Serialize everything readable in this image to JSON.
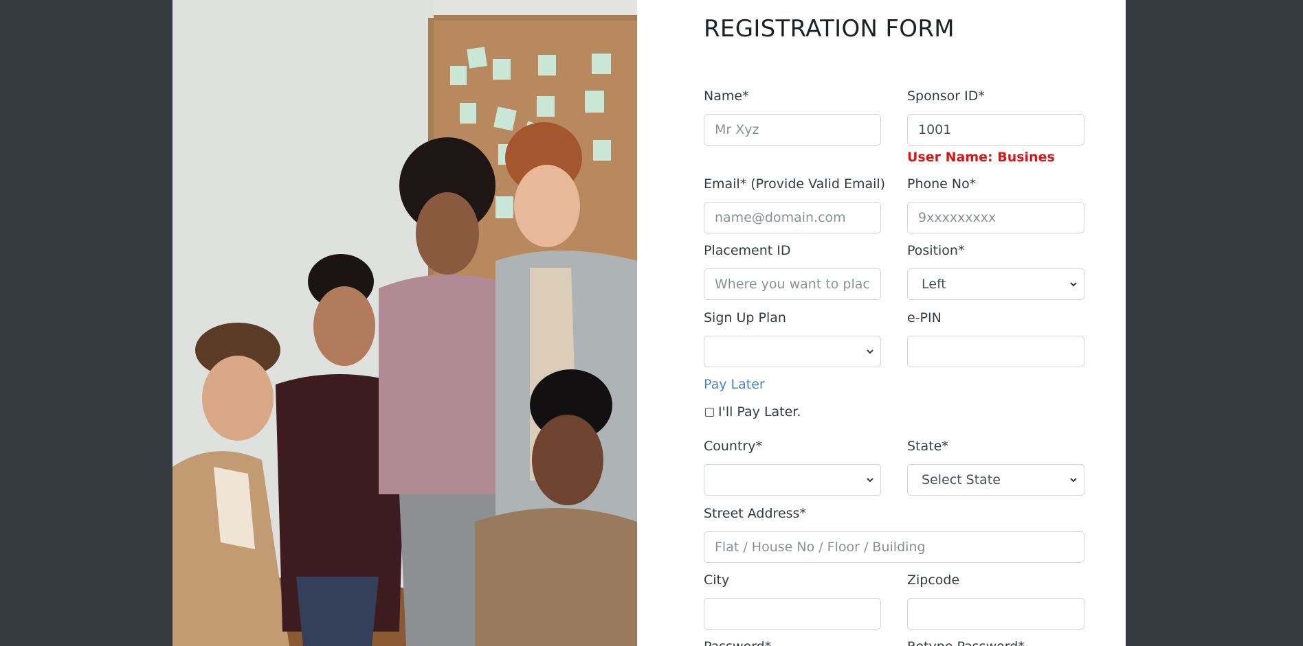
{
  "form": {
    "title": "REGISTRATION FORM",
    "name": {
      "label": "Name*",
      "placeholder": "Mr Xyz",
      "value": ""
    },
    "sponsor": {
      "label": "Sponsor ID*",
      "value": "1001",
      "message": "User Name: Busines"
    },
    "email": {
      "label": "Email* (Provide Valid Email)",
      "placeholder": "name@domain.com"
    },
    "phone": {
      "label": "Phone No*",
      "placeholder": "9xxxxxxxxx"
    },
    "placement": {
      "label": "Placement ID",
      "placeholder": "Where you want to place"
    },
    "position": {
      "label": "Position*",
      "selected": "Left"
    },
    "plan": {
      "label": "Sign Up Plan",
      "selected": ""
    },
    "epin": {
      "label": "e-PIN",
      "value": ""
    },
    "pay_later": {
      "link_label": "Pay Later",
      "checkbox_label": "I'll Pay Later.",
      "checked": false
    },
    "country": {
      "label": "Country*",
      "selected": ""
    },
    "state": {
      "label": "State*",
      "selected": "Select State"
    },
    "street": {
      "label": "Street Address*",
      "placeholder": "Flat / House No / Floor / Building"
    },
    "city": {
      "label": "City",
      "value": ""
    },
    "zip": {
      "label": "Zipcode",
      "value": ""
    },
    "password": {
      "label": "Password*"
    },
    "retype_password": {
      "label": "Retype Password*"
    }
  },
  "colors": {
    "page_background": "#343a40",
    "error_text": "#dc1616",
    "link_text": "#4f7fc6"
  },
  "photo": {
    "icon": "team-photo"
  }
}
